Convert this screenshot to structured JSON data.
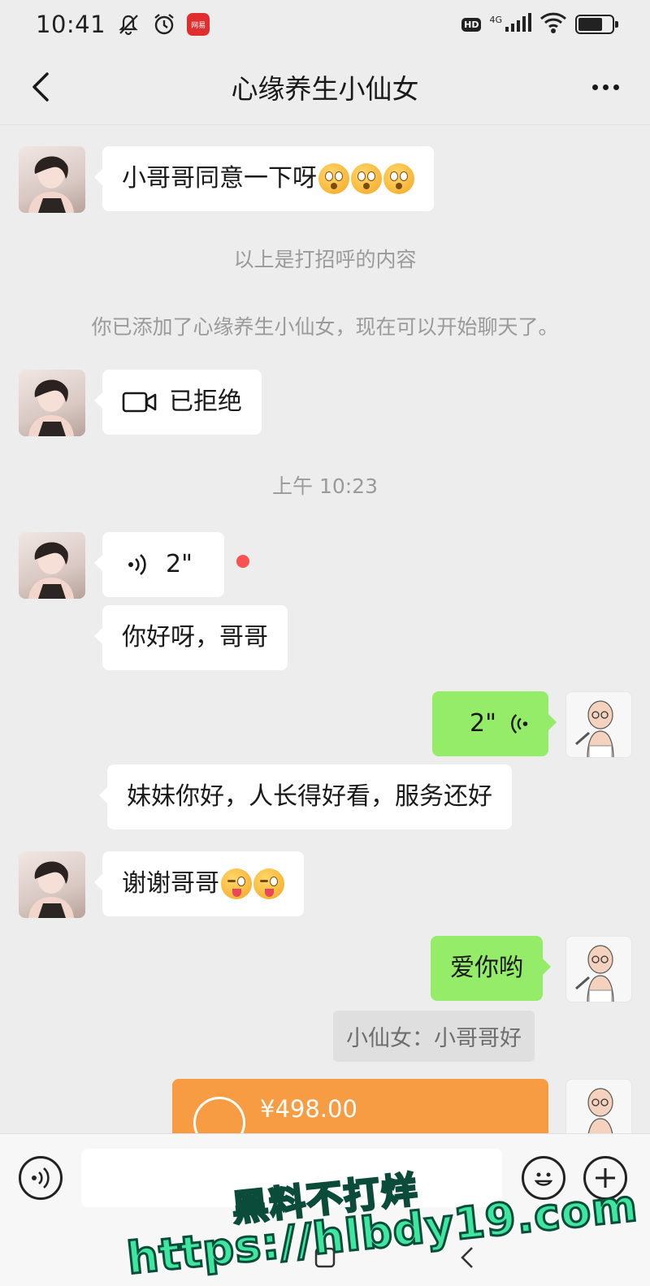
{
  "status_bar": {
    "time": "10:41",
    "app_badge_text": "网易",
    "hd_label": "HD",
    "network_label": "4G"
  },
  "header": {
    "title": "心缘养生小仙女",
    "back_icon": "chevron-left-icon",
    "more_icon": "more-dots-icon"
  },
  "messages": {
    "m1": {
      "text": "小哥哥同意一下呀",
      "emoji": "flushed-face-emoji"
    },
    "sys1": "以上是打招呼的内容",
    "sys2": "你已添加了心缘养生小仙女，现在可以开始聊天了。",
    "m2": {
      "icon": "video-call-icon",
      "text": "已拒绝"
    },
    "time1": "上午 10:23",
    "m3": {
      "icon": "voice-icon",
      "duration": "2\""
    },
    "m4": {
      "text": "你好呀，哥哥"
    },
    "m5": {
      "icon": "voice-icon",
      "duration": "2\""
    },
    "m6": {
      "text": "妹妹你好，人长得好看，服务还好"
    },
    "m7": {
      "text": "谢谢哥哥",
      "emoji": "winking-tongue-emoji"
    },
    "m8": {
      "text": "爱你哟"
    },
    "m8_quote": "小仙女：小哥哥好",
    "m9": {
      "amount": "¥498.00",
      "icon": "transfer-icon"
    }
  },
  "colors": {
    "background": "#ededed",
    "sent_bubble": "#95ec69",
    "received_bubble": "#ffffff",
    "transfer_bubble": "#f79c42",
    "unread_dot": "#fa5151"
  },
  "input_bar": {
    "voice_icon": "voice-mode-icon",
    "emoji_icon": "emoji-icon",
    "plus_icon": "plus-icon"
  },
  "watermark": {
    "line1": "黑料不打烊",
    "line2": "https://hlbdy19.com"
  }
}
